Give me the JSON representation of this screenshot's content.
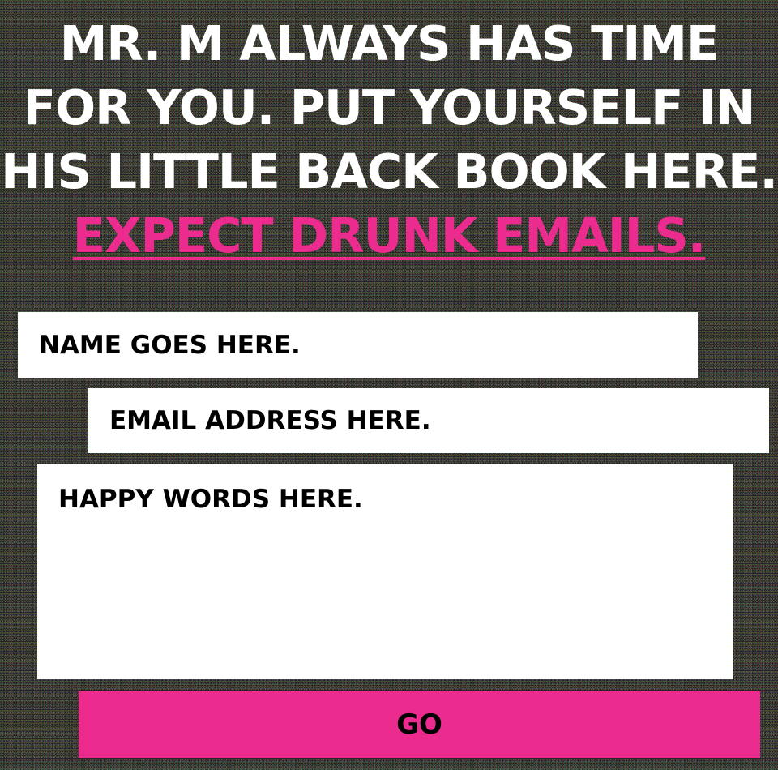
{
  "headline": {
    "lines": [
      "MR. M ALWAYS HAS TIME",
      "FOR YOU. PUT YOURSELF IN",
      "HIS LITTLE BACK BOOK HERE."
    ],
    "accent": "EXPECT DRUNK EMAILS."
  },
  "form": {
    "name_placeholder": "NAME GOES HERE.",
    "email_placeholder": "EMAIL ADDRESS HERE.",
    "message_placeholder": "HAPPY WORDS HERE.",
    "submit_label": "GO"
  },
  "colors": {
    "background": "#232323",
    "accent": "#ec2b8f",
    "field_background": "#ffffff",
    "text": "#000000",
    "headline_text": "#ffffff"
  }
}
